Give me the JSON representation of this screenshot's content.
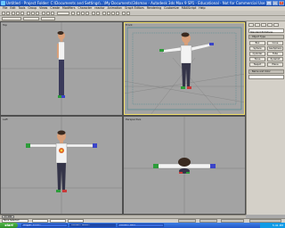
{
  "window": {
    "title": "Untitled - Project Folder: C:\\Documents and Settings\\...\\My Documents\\3dsmax - Autodesk 3ds Max 9 SP1 - Educational - Not for Commercial Use",
    "icon": "3dsmax-logo-icon"
  },
  "menu": [
    "File",
    "Edit",
    "Tools",
    "Group",
    "Views",
    "Create",
    "Modifiers",
    "Character",
    "reactor",
    "Animation",
    "Graph Editors",
    "Rendering",
    "Customize",
    "MAXScript",
    "Help"
  ],
  "viewports": {
    "top": "Top",
    "front": "Front",
    "left": "Left",
    "perspective": "Perspective",
    "active": "front"
  },
  "command_panel": {
    "tabs": [
      "create-icon",
      "modify-icon",
      "hierarchy-icon",
      "motion-icon",
      "display-icon",
      "utilities-icon"
    ],
    "category": "Standard Primitives",
    "object_type_header": "- Object Type",
    "buttons": [
      "Box",
      "Cone",
      "Sphere",
      "GeoSphere",
      "Cylinder",
      "Tube",
      "Torus",
      "Pyramid",
      "Teapot",
      "Plane"
    ],
    "name_color_header": "- Name and Color"
  },
  "timeline": {
    "frame_label": "0 / 100"
  },
  "status": {
    "selection": "None Selected"
  },
  "taskbar": {
    "start": "start",
    "tasks": [
      "Blogger: Introd...",
      "Untitled - Autod...",
      "Untitled - Paint"
    ],
    "clock": "5:41 PM"
  },
  "colors": {
    "viewport_bg": "#a3a3a3",
    "active_viewport_border": "#f2e06d",
    "xp_taskbar": "#2358c8"
  }
}
